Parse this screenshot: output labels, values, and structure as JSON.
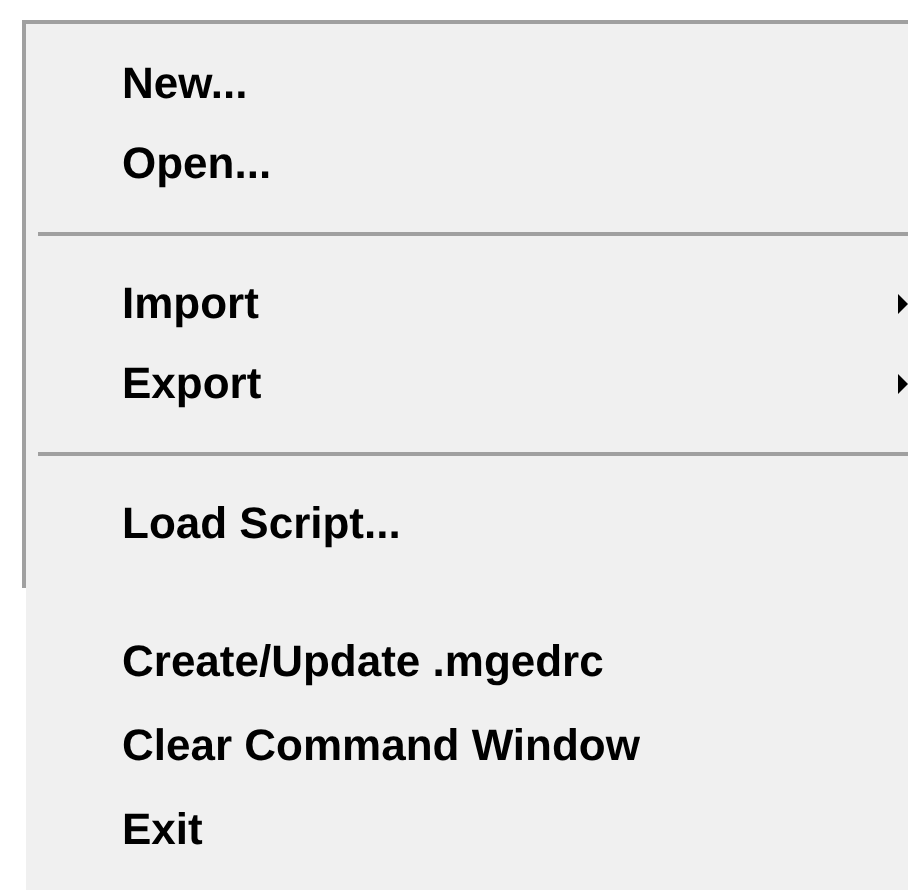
{
  "panels": [
    {
      "framed": true,
      "items": [
        {
          "kind": "item",
          "label": "New...",
          "submenu": false
        },
        {
          "kind": "item",
          "label": "Open...",
          "submenu": false
        },
        {
          "kind": "separator"
        },
        {
          "kind": "item",
          "label": "Import",
          "submenu": true
        },
        {
          "kind": "item",
          "label": "Export",
          "submenu": true
        },
        {
          "kind": "separator"
        },
        {
          "kind": "item",
          "label": "Load Script...",
          "submenu": false
        }
      ]
    },
    {
      "framed": false,
      "items": [
        {
          "kind": "item",
          "label": "Create/Update .mgedrc",
          "submenu": false
        },
        {
          "kind": "item",
          "label": "Clear Command Window",
          "submenu": false
        },
        {
          "kind": "item",
          "label": "Exit",
          "submenu": false
        }
      ]
    }
  ]
}
